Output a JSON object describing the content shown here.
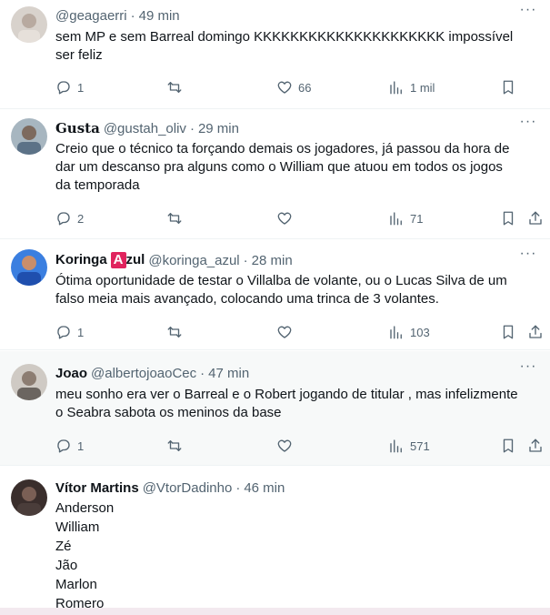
{
  "tweets": [
    {
      "name": "",
      "handle": "@geagaerri",
      "time": "49 min",
      "lines": [
        "sem MP e sem Barreal domingo KKKKKKKKKKKKKKKKKKKKK impossível",
        "ser feliz"
      ],
      "replies": "1",
      "retweets": "",
      "likes": "66",
      "views": "1 mil",
      "avatar_color": "#c9c2bb"
    },
    {
      "name": "Gusta",
      "handle": "@gustah_oliv",
      "time": "29 min",
      "lines": [
        "Creio que o técnico ta forçando demais os jogadores, já passou da hora de",
        "dar um descanso pra alguns como o William que atuou em todos os jogos",
        "da temporada"
      ],
      "replies": "2",
      "retweets": "",
      "likes": "",
      "views": "71",
      "avatar_color": "#8a9aa6"
    },
    {
      "name": "Koringa",
      "name_badge": "A",
      "name_suffix": "zul",
      "handle": "@koringa_azul",
      "time": "28 min",
      "lines": [
        "Ótima oportunidade de testar o Villalba de volante, ou o Lucas Silva de um",
        "falso meia mais avançado, colocando uma trinca de 3 volantes."
      ],
      "replies": "1",
      "retweets": "",
      "likes": "",
      "views": "103",
      "avatar_color": "#2d6fd6"
    },
    {
      "name": "Joao",
      "handle": "@albertojoaoCec",
      "time": "47 min",
      "lines": [
        "meu sonho era ver o Barreal e o Robert jogando de titular , mas infelizmente",
        "o Seabra sabota os meninos da base"
      ],
      "replies": "1",
      "retweets": "",
      "likes": "",
      "views": "571",
      "avatar_color": "#9a9590"
    },
    {
      "name": "Vítor Martins",
      "handle": "@VtorDadinho",
      "time": "46 min",
      "lines": [
        "Anderson",
        "William",
        "Zé",
        "Jão",
        "Marlon",
        "Romero"
      ],
      "avatar_color": "#5b4a45"
    }
  ],
  "more_label": "···",
  "separator": "·"
}
